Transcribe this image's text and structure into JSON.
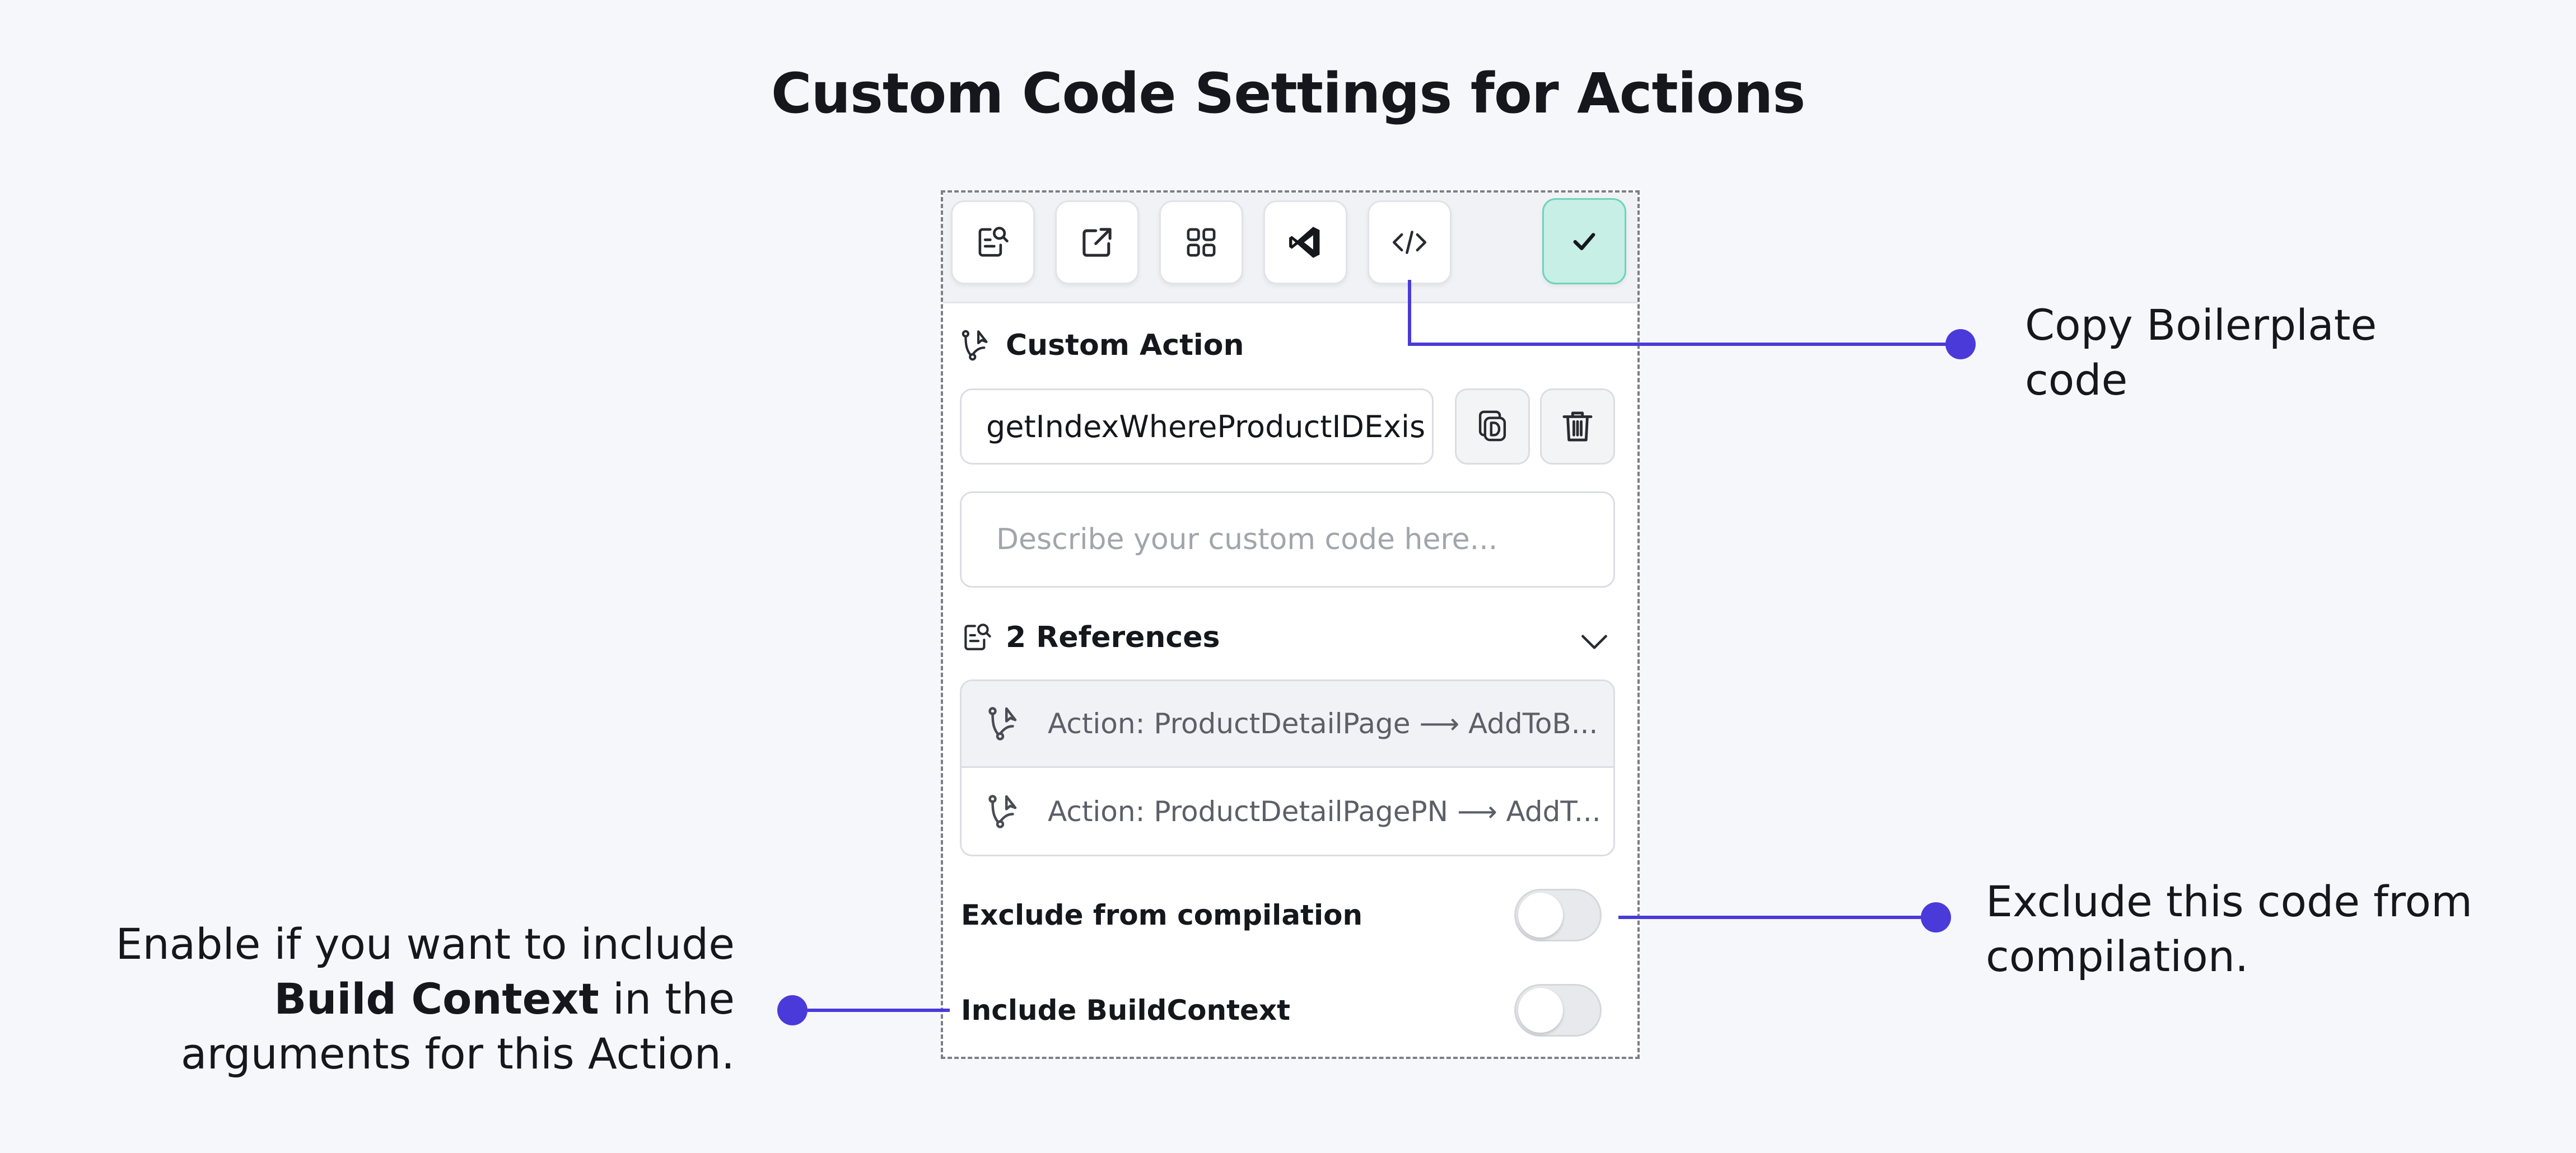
{
  "page": {
    "title": "Custom Code Settings for Actions"
  },
  "toolbar": {
    "buttons": [
      {
        "icon": "references-search-icon"
      },
      {
        "icon": "open-external-icon"
      },
      {
        "icon": "grid-icon"
      },
      {
        "icon": "vscode-icon"
      },
      {
        "icon": "code-icon"
      },
      {
        "icon": "check-icon"
      }
    ],
    "confirm_color": "#c7efe6"
  },
  "custom_action": {
    "label": "Custom Action",
    "name_value": "getIndexWhereProductIDExis",
    "description_placeholder": "Describe your custom code here..."
  },
  "references": {
    "label": "2 References",
    "items": [
      {
        "text": "Action: ProductDetailPage ⟶ AddToB..."
      },
      {
        "text": "Action: ProductDetailPagePN ⟶ AddT..."
      }
    ]
  },
  "settings": {
    "exclude_label": "Exclude from compilation",
    "exclude_on": false,
    "build_context_label": "Include BuildContext",
    "build_context_on": false
  },
  "callouts": {
    "copy_boilerplate": [
      "Copy Boilerplate",
      "code"
    ],
    "exclude": [
      "Exclude this code from",
      "compilation."
    ],
    "build_context_pre": "Enable if you want to include",
    "build_context_bold": "Build Context",
    "build_context_post": " in the",
    "build_context_line3": "arguments for this Action."
  },
  "colors": {
    "accent": "#4a3ad9",
    "background": "#f6f7fb"
  }
}
